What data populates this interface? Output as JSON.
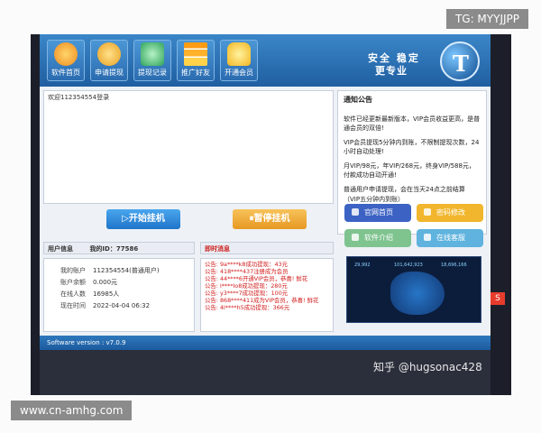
{
  "overlay": {
    "tg_label": "TG: MYYJJPP",
    "site_label": "www.cn-amhg.com",
    "watermark": "知乎 @hugsonac428"
  },
  "toolbar": {
    "items": [
      {
        "label": "软件首页",
        "icon": "sun-icon"
      },
      {
        "label": "申请提现",
        "icon": "coin-bag-icon"
      },
      {
        "label": "提现记录",
        "icon": "record-icon"
      },
      {
        "label": "推广好友",
        "icon": "bar-chart-icon"
      },
      {
        "label": "开通会员",
        "icon": "crown-icon"
      }
    ]
  },
  "brand": {
    "line1": "安全 稳定",
    "line2": "更专业",
    "logo": "T"
  },
  "login_log": {
    "text": "欢迎112354554登录"
  },
  "notice": {
    "title": "通知公告",
    "items": [
      "软件已经更新最新版本，VIP会员收益更高，是普通会员的双倍!",
      "VIP会员提现5分钟内到账，不限制提现次数，24小时自动处理!",
      "月VIP/98元，年VIP/268元，终身VIP/588元，付款成功自动开通!",
      "普通用户申请提现，会在当天24点之前结算（VIP五分钟内到账）"
    ]
  },
  "actions": {
    "start_label": "▷开始挂机",
    "pause_label": "⏸暂停挂机"
  },
  "user": {
    "header": "用户信息",
    "id_label": "我的ID：77586",
    "fields": [
      {
        "key": "我的账户",
        "value": "112354554(普通用户)"
      },
      {
        "key": "账户余额",
        "value": "0.000元"
      },
      {
        "key": "在线人数",
        "value": "16985人"
      },
      {
        "key": "现在时间",
        "value": "2022-04-04  06:32"
      }
    ]
  },
  "realtime": {
    "header": "即时消息",
    "messages": [
      "公告: 9a****k8成功提现：43元",
      "公告: 418****437注册成为会员",
      "公告: 44****6开通VIP会员，恭喜! 鲜花",
      "公告: l****lo8成功提现：280元",
      "公告: y3****7成功提现：100元",
      "公告: 868****411成为VIP会员，恭喜! 鲜花",
      "公告: 4l****h5成功提现：366元"
    ]
  },
  "side_buttons": {
    "home": "官网首页",
    "password": "密码修改",
    "intro": "软件介绍",
    "support": "在线客服"
  },
  "map": {
    "stats": [
      "29,992",
      "101,642,923",
      "18,696,166"
    ]
  },
  "status": {
    "version": "Software version : v7.0.9"
  },
  "colors": {
    "toolbar_blue": "#2b6cb0",
    "start_blue": "#1f74c8",
    "pause_orange": "#e79822",
    "message_red": "#d21c1c"
  }
}
